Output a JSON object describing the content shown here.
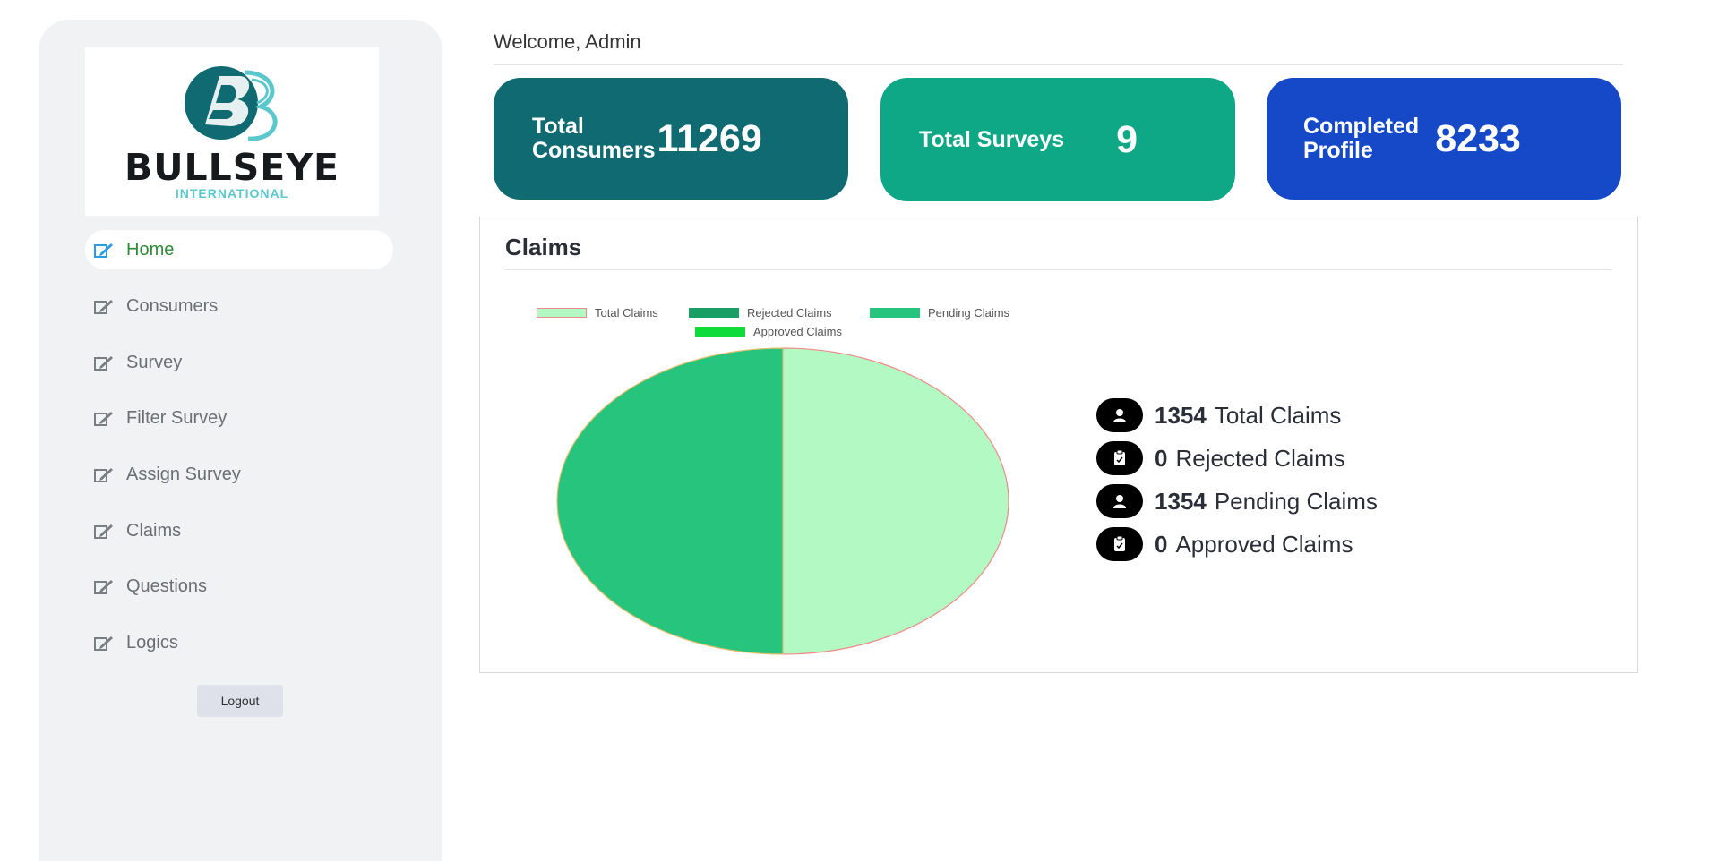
{
  "logo": {
    "title": "BULLSEYE",
    "subtitle": "INTERNATIONAL"
  },
  "sidebar": {
    "items": [
      {
        "label": "Home",
        "active": true
      },
      {
        "label": "Consumers"
      },
      {
        "label": "Survey"
      },
      {
        "label": "Filter Survey"
      },
      {
        "label": "Assign Survey"
      },
      {
        "label": "Claims"
      },
      {
        "label": "Questions"
      },
      {
        "label": "Logics"
      }
    ],
    "logout_label": "Logout"
  },
  "header": {
    "welcome": "Welcome, Admin"
  },
  "cards": [
    {
      "label_line1": "Total",
      "label_line2": "Consumers",
      "value": "11269",
      "color": "#0f6a72"
    },
    {
      "label": "Total Surveys",
      "value": "9",
      "color": "#0fa887"
    },
    {
      "label_line1": "Completed",
      "label_line2": "Profile",
      "value": "8233",
      "color": "#1649c8"
    }
  ],
  "claims_panel": {
    "title": "Claims",
    "stats": [
      {
        "value": "1354",
        "label": "Total Claims",
        "icon": "user-icon"
      },
      {
        "value": "0",
        "label": "Rejected Claims",
        "icon": "clipboard-icon"
      },
      {
        "value": "1354",
        "label": "Pending Claims",
        "icon": "user-icon"
      },
      {
        "value": "0",
        "label": "Approved Claims",
        "icon": "clipboard-icon"
      }
    ]
  },
  "chart_data": {
    "type": "pie",
    "categories": [
      "Total Claims",
      "Rejected Claims",
      "Pending Claims",
      "Approved Claims"
    ],
    "values": [
      1354,
      0,
      1354,
      0
    ],
    "colors": [
      "#b3f9c3",
      "#199f65",
      "#27c47e",
      "#0fdc3a"
    ],
    "legend": "top"
  }
}
